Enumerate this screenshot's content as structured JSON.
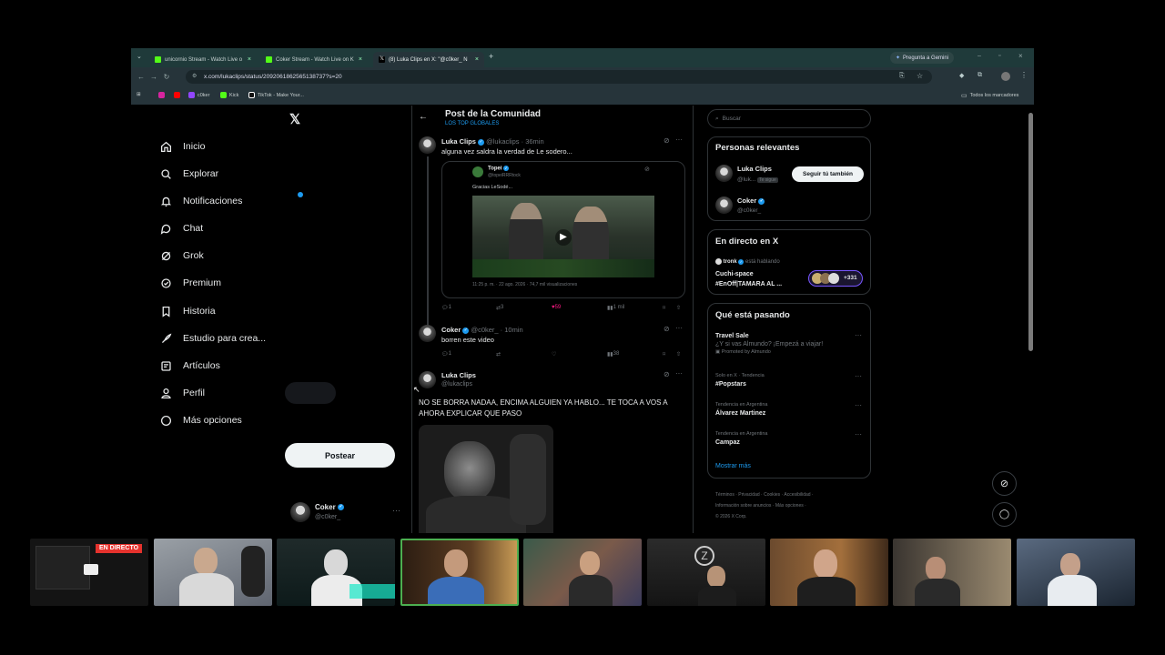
{
  "browser": {
    "tabs": [
      {
        "label": "unicornio Stream - Watch Live o",
        "active": false
      },
      {
        "label": "Coker Stream - Watch Live on K",
        "active": false
      },
      {
        "label": "(8) Luka Clips en X: \"@c0ker_ N",
        "active": true
      }
    ],
    "gemini_label": "Pregunta a Gemini",
    "url": "x.com/lukaclips/status/2092061862565138737?s=20",
    "bookmarks": [
      "c0ker",
      "Kick",
      "TikTok - Make Your..."
    ],
    "all_bookmarks": "Todos los marcadores"
  },
  "sidebar": {
    "items": [
      {
        "label": "Inicio",
        "icon": "home-icon"
      },
      {
        "label": "Explorar",
        "icon": "search-icon"
      },
      {
        "label": "Notificaciones",
        "icon": "bell-icon"
      },
      {
        "label": "Chat",
        "icon": "chat-icon"
      },
      {
        "label": "Grok",
        "icon": "grok-icon"
      },
      {
        "label": "Premium",
        "icon": "premium-icon"
      },
      {
        "label": "Historia",
        "icon": "bookmark-icon"
      },
      {
        "label": "Estudio para crea...",
        "icon": "rocket-icon"
      },
      {
        "label": "Artículos",
        "icon": "article-icon"
      },
      {
        "label": "Perfil",
        "icon": "person-icon"
      },
      {
        "label": "Más opciones",
        "icon": "more-icon"
      }
    ],
    "post_button": "Postear",
    "account": {
      "name": "Coker",
      "handle": "@c0ker_"
    }
  },
  "main": {
    "header_title": "Post de la Comunidad",
    "header_sub": "LOS TOP GLOBALES",
    "posts": [
      {
        "name": "Luka Clips",
        "handle": "@lukaclips",
        "time": "· 36min",
        "text": "alguna vez saldra la verdad de Le sodero...",
        "quote": {
          "name": "Topei",
          "handle": "@topeiRRRtock",
          "text": "Gracias LeSodé...",
          "meta": "11:25 p. m. · 22 ago. 2026 · 74,7 mil visualizaciones"
        },
        "replies": "1",
        "reposts": "3",
        "likes": "59",
        "views": "1 mil"
      },
      {
        "name": "Coker",
        "handle": "@c0ker_",
        "time": "· 10min",
        "text": "borren este video",
        "replies": "1",
        "reposts": "",
        "likes": "",
        "views": "38"
      },
      {
        "name": "Luka Clips",
        "handle": "@lukaclips",
        "text": "NO SE BORRA NADAA, ENCIMA ALGUIEN YA HABLO... TE TOCA A VOS A AHORA EXPLICAR QUE PASO"
      }
    ]
  },
  "right": {
    "search_placeholder": "Buscar",
    "relevant_title": "Personas relevantes",
    "people": [
      {
        "name": "Luka Clips",
        "handle": "@luk...",
        "badge": "Te sigue"
      },
      {
        "name": "Coker",
        "handle": "@c0ker_"
      }
    ],
    "follow_button": "Seguir tú también",
    "live_title": "En directo en X",
    "live_host": "tronk",
    "live_host_suffix": "está hablando",
    "live_line1": "Cuchi-space",
    "live_line2": "#EnOff|TAMARA AL ...",
    "live_count": "+331",
    "trends_title": "Qué está pasando",
    "trends": [
      {
        "cat": "Travel Sale",
        "title": "¿Y si vas Almundo? ¡Empezá a viajar!",
        "promo": "Promoted by Almundo"
      },
      {
        "cat": "Solo en X · Tendencia",
        "title": "#Popstars"
      },
      {
        "cat": "Tendencia en Argentina",
        "title": "Álvarez Martinez"
      },
      {
        "cat": "Tendencia en Argentina",
        "title": "Campaz"
      }
    ],
    "show_more": "Mostrar más",
    "footer": [
      "Términos",
      "Privacidad",
      "Cookies",
      "Accesibilidad",
      "Información sobre anuncios",
      "Más opciones",
      "© 2026 X Corp."
    ]
  },
  "stream": {
    "live_badge": "EN DIRECTO"
  },
  "colors": {
    "accent": "#1d9bf0",
    "like": "#f91880",
    "live": "#e5322d",
    "tab_bar": "#1f3a3a",
    "kick_green": "#53fc18"
  }
}
